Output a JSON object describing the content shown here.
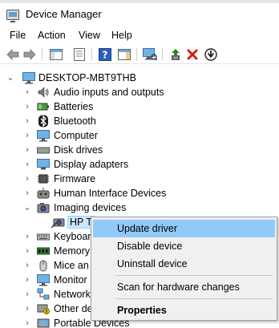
{
  "window": {
    "title": "Device Manager"
  },
  "menu": {
    "items": [
      "File",
      "Action",
      "View",
      "Help"
    ]
  },
  "toolbar": {
    "buttons": [
      "back-icon",
      "forward-icon",
      "show-hide-tree-icon",
      "properties-icon",
      "help-icon",
      "action-pane-icon",
      "scan-hardware-icon",
      "update-driver-icon",
      "uninstall-device-icon",
      "disable-device-icon"
    ]
  },
  "tree": {
    "root": "DESKTOP-MBT9THB",
    "categories": [
      {
        "label": "Audio inputs and outputs",
        "icon": "speaker-icon"
      },
      {
        "label": "Batteries",
        "icon": "battery-icon"
      },
      {
        "label": "Bluetooth",
        "icon": "bluetooth-icon"
      },
      {
        "label": "Computer",
        "icon": "computer-icon"
      },
      {
        "label": "Disk drives",
        "icon": "disk-drive-icon"
      },
      {
        "label": "Display adapters",
        "icon": "display-adapter-icon"
      },
      {
        "label": "Firmware",
        "icon": "firmware-icon"
      },
      {
        "label": "Human Interface Devices",
        "icon": "hid-icon"
      },
      {
        "label": "Imaging devices",
        "icon": "camera-icon",
        "expanded": true
      },
      {
        "label": "Keyboar",
        "icon": "keyboard-icon"
      },
      {
        "label": "Memory",
        "icon": "memory-icon"
      },
      {
        "label": "Mice an",
        "icon": "mouse-icon"
      },
      {
        "label": "Monitor",
        "icon": "monitor-icon"
      },
      {
        "label": "Network",
        "icon": "network-icon"
      },
      {
        "label": "Other de",
        "icon": "other-devices-icon"
      },
      {
        "label": "Portable Devices",
        "icon": "portable-devices-icon"
      }
    ],
    "child": {
      "label": "HP T",
      "icon": "camera-icon"
    }
  },
  "context_menu": {
    "items": [
      {
        "label": "Update driver",
        "highlighted": true
      },
      {
        "label": "Disable device"
      },
      {
        "label": "Uninstall device"
      },
      {
        "label": "Scan for hardware changes"
      },
      {
        "label": "Properties",
        "bold": true
      }
    ]
  },
  "colors": {
    "selection": "#cce8ff",
    "menu_highlight": "#91c9f7",
    "menu_bg": "#f0f0f0",
    "uninstall_red": "#d7191c",
    "update_green": "#1e8c1e",
    "help_blue": "#2b5fb8"
  }
}
